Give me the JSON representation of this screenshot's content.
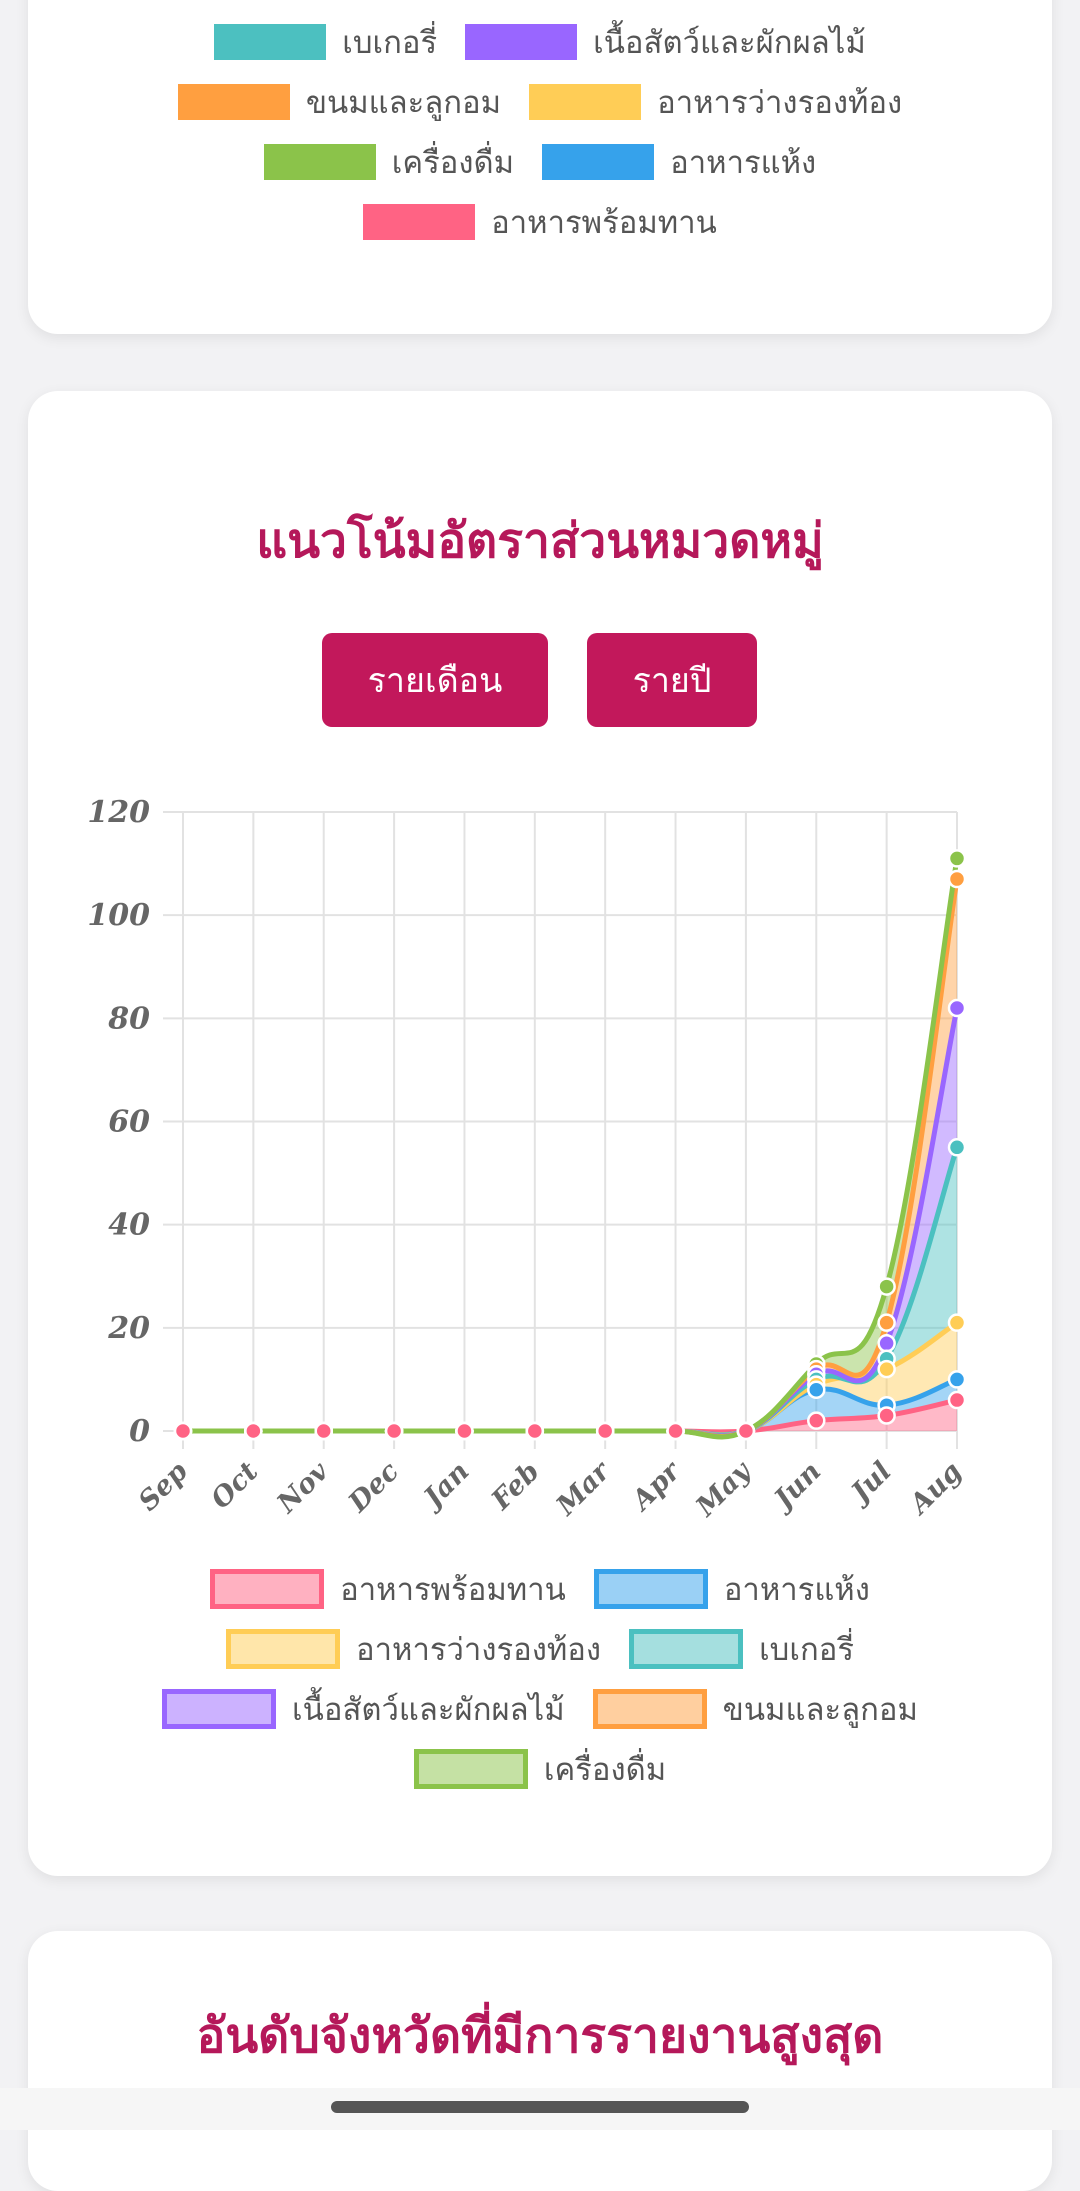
{
  "top_legend": {
    "rows": [
      [
        {
          "label": "เบเกอรี่",
          "color": "#4cc0c0"
        },
        {
          "label": "เนื้อสัตว์และผักผลไม้",
          "color": "#9966ff"
        }
      ],
      [
        {
          "label": "ขนมและลูกอม",
          "color": "#ff9f40"
        },
        {
          "label": "อาหารว่างรองท้อง",
          "color": "#ffcd56"
        }
      ],
      [
        {
          "label": "เครื่องดื่ม",
          "color": "#8bc34a"
        },
        {
          "label": "อาหารแห้ง",
          "color": "#36a2eb"
        }
      ],
      [
        {
          "label": "อาหารพร้อมทาน",
          "color": "#ff6384"
        }
      ]
    ]
  },
  "chart_section": {
    "title": "แนวโน้มอัตราส่วนหมวดหมู่",
    "buttons": {
      "monthly": "รายเดือน",
      "yearly": "รายปี"
    }
  },
  "chart_data": {
    "type": "area",
    "stacked": true,
    "title": "แนวโน้มอัตราส่วนหมวดหมู่",
    "categories": [
      "Sep",
      "Oct",
      "Nov",
      "Dec",
      "Jan",
      "Feb",
      "Mar",
      "Apr",
      "May",
      "Jun",
      "Jul",
      "Aug"
    ],
    "ylim": [
      0,
      120
    ],
    "yticks": [
      0,
      20,
      40,
      60,
      80,
      100,
      120
    ],
    "grid": true,
    "legend_position": "bottom",
    "series": [
      {
        "name": "อาหารพร้อมทาน",
        "color": "#ff6384",
        "values": [
          0,
          0,
          0,
          0,
          0,
          0,
          0,
          0,
          0,
          2,
          3,
          6
        ]
      },
      {
        "name": "อาหารแห้ง",
        "color": "#36a2eb",
        "values": [
          0,
          0,
          0,
          0,
          0,
          0,
          0,
          0,
          0,
          6,
          2,
          4
        ]
      },
      {
        "name": "อาหารว่างรองท้อง",
        "color": "#ffcd56",
        "values": [
          0,
          0,
          0,
          0,
          0,
          0,
          0,
          0,
          0,
          1,
          7,
          11
        ]
      },
      {
        "name": "เบเกอรี่",
        "color": "#4bc0c0",
        "values": [
          0,
          0,
          0,
          0,
          0,
          0,
          0,
          0,
          0,
          1,
          2,
          34
        ]
      },
      {
        "name": "เนื้อสัตว์และผักผลไม้",
        "color": "#9966ff",
        "values": [
          0,
          0,
          0,
          0,
          0,
          0,
          0,
          0,
          0,
          1,
          3,
          27
        ]
      },
      {
        "name": "ขนมและลูกอม",
        "color": "#ff9f40",
        "values": [
          0,
          0,
          0,
          0,
          0,
          0,
          0,
          0,
          0,
          1,
          4,
          25
        ]
      },
      {
        "name": "เครื่องดื่ม",
        "color": "#8bc34a",
        "values": [
          0,
          0,
          0,
          0,
          0,
          0,
          0,
          0,
          0,
          1,
          7,
          4
        ]
      }
    ]
  },
  "bottom_section": {
    "title": "อันดับจังหวัดที่มีการรายงานสูงสุด"
  }
}
